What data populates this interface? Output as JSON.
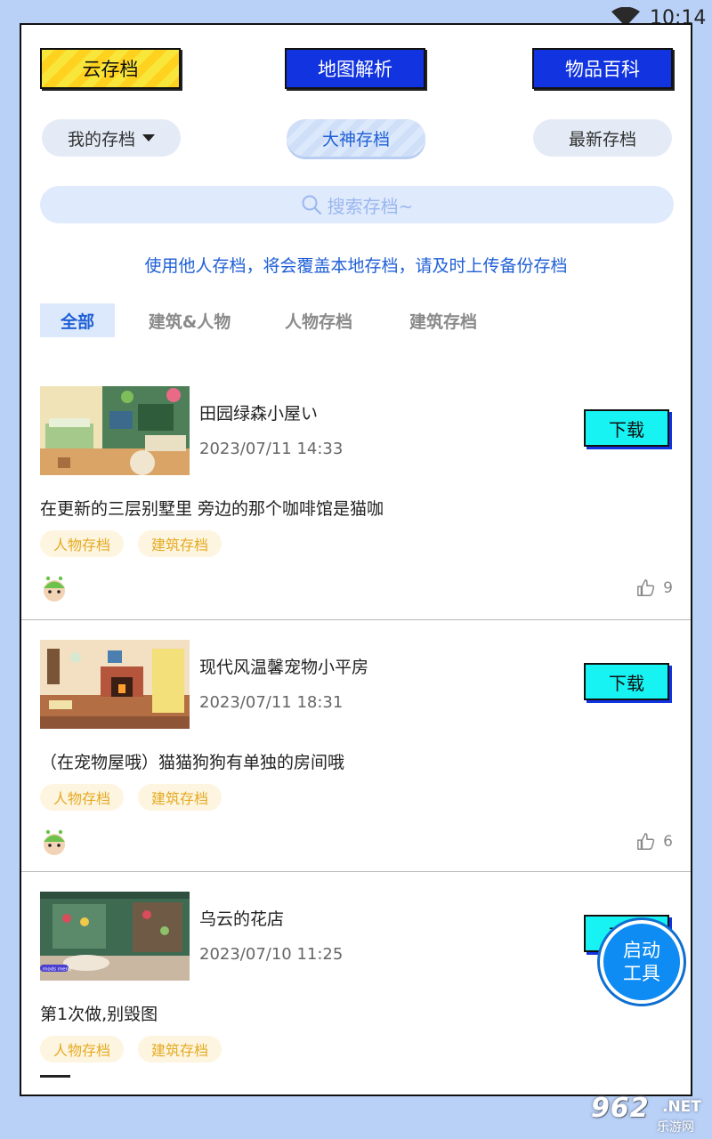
{
  "status": {
    "time": "10:14",
    "icon": "wifi-icon"
  },
  "top_buttons": [
    "云存档",
    "地图解析",
    "物品百科"
  ],
  "filters": {
    "my_label": "我的存档",
    "master_label": "大神存档",
    "latest_label": "最新存档"
  },
  "search": {
    "placeholder": "搜索存档~"
  },
  "notice": "使用他人存档，将会覆盖本地存档，请及时上传备份存档",
  "categories": [
    "全部",
    "建筑&人物",
    "人物存档",
    "建筑存档"
  ],
  "cards": [
    {
      "title": "田园绿森小屋い",
      "date": "2023/07/11 14:33",
      "desc": "在更新的三层别墅里 旁边的那个咖啡馆是猫咖",
      "tags": [
        "人物存档",
        "建筑存档"
      ],
      "likes": "9",
      "download": "下载"
    },
    {
      "title": "现代风温馨宠物小平房",
      "date": "2023/07/11 18:31",
      "desc": "（在宠物屋哦）猫猫狗狗有单独的房间哦",
      "tags": [
        "人物存档",
        "建筑存档"
      ],
      "likes": "6",
      "download": "下载"
    },
    {
      "title": "乌云的花店",
      "date": "2023/07/10 11:25",
      "desc": "第1次做,别毁图",
      "tags": [
        "人物存档",
        "建筑存档"
      ],
      "download": "下载",
      "thumb_label": "mods menu"
    }
  ],
  "fab": {
    "line1": "启动",
    "line2": "工具"
  },
  "watermark": {
    "num": "962",
    "net": ".NET",
    "cn": "乐游网"
  },
  "colors": {
    "accent_blue": "#1133e0",
    "cyan": "#17f2f2",
    "link_blue": "#1f5fd6",
    "tag_orange": "#e5aa22",
    "background": "#b9d0f7"
  }
}
